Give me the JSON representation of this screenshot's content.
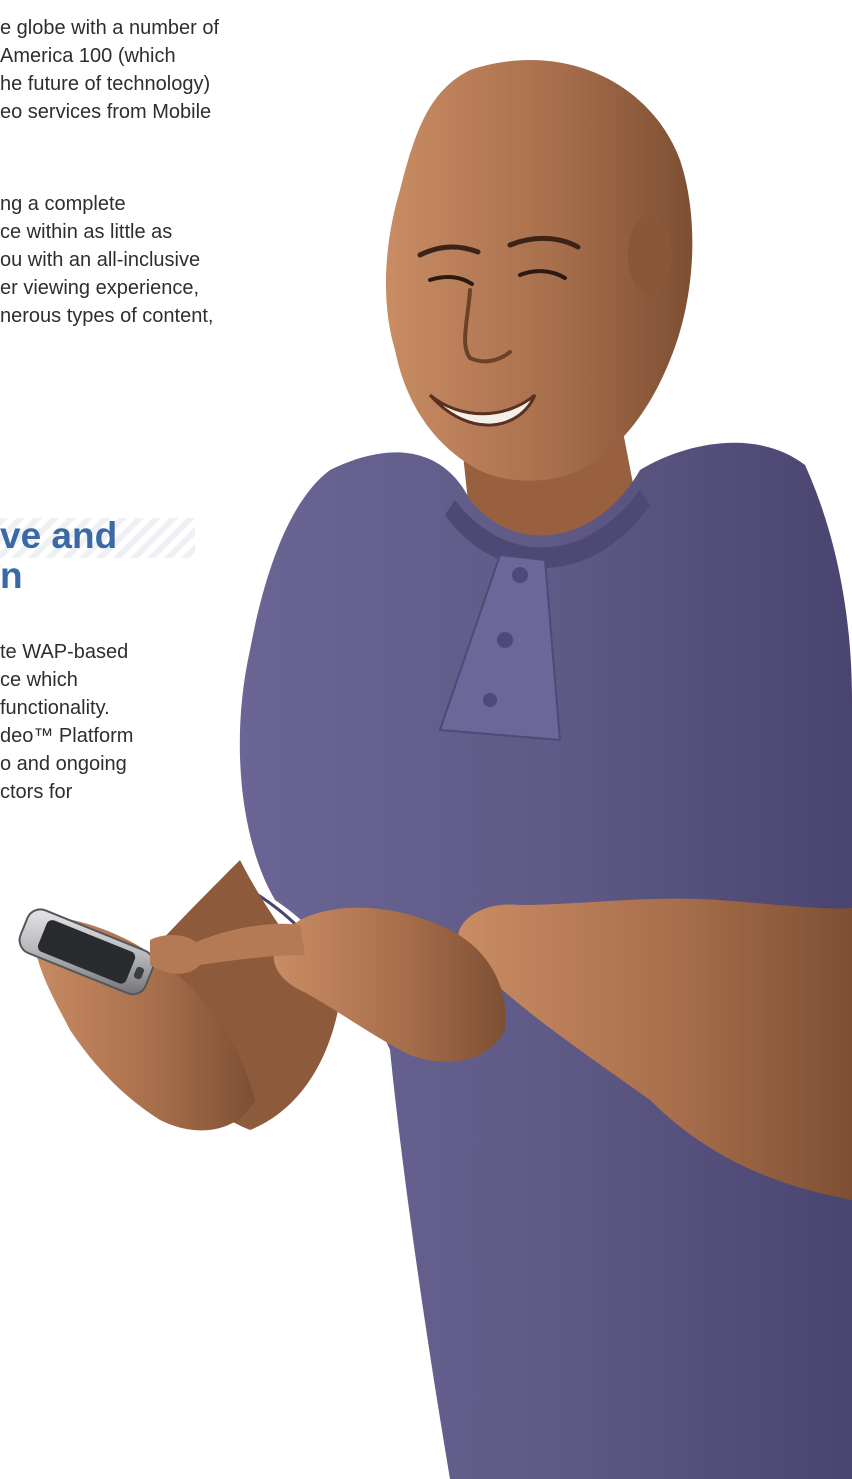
{
  "article": {
    "paragraph_1": {
      "lines": [
        "e globe with a number of",
        "America 100 (which",
        "he future of technology)",
        "eo services from Mobile"
      ]
    },
    "paragraph_2": {
      "lines": [
        "ng a complete",
        "ce within as little as",
        "ou with an all-inclusive",
        "er viewing experience,",
        "nerous types of content,"
      ]
    },
    "heading": {
      "lines": [
        "ve and",
        "n"
      ]
    },
    "paragraph_3": {
      "lines": [
        "te WAP-based",
        "ce which",
        " functionality.",
        "deo™ Platform",
        "o and ongoing",
        "ctors for"
      ]
    }
  },
  "colors": {
    "heading": "#3a6aa5",
    "body_text": "#2e2e2e",
    "shirt": "#5f5a86",
    "skin": "#a86f4c"
  },
  "photo": {
    "subject": "man-smiling-using-smartphone",
    "icon": "person-with-phone-photo"
  }
}
